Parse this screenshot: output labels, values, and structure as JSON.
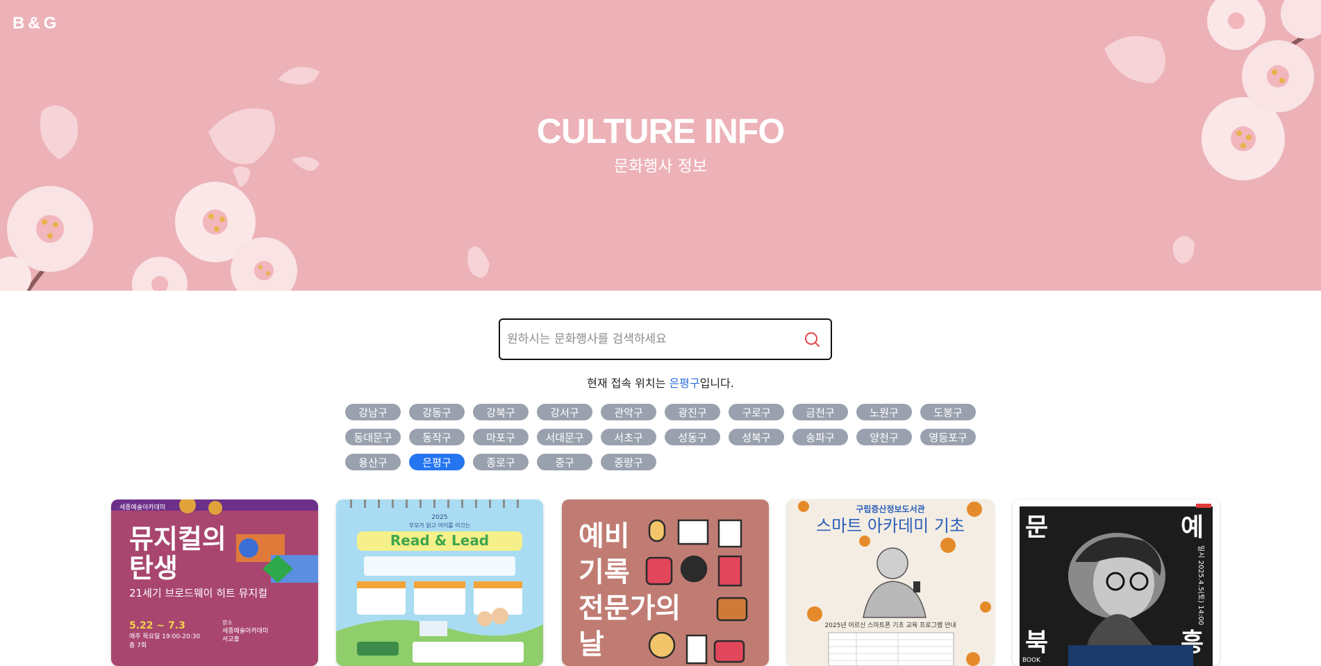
{
  "brand": {
    "logo": "B&G"
  },
  "hero": {
    "title": "CULTURE INFO",
    "subtitle": "문화행사 정보",
    "background_color": "#ecb2b8"
  },
  "search": {
    "placeholder": "원하시는 문화행사를 검색하세요",
    "value": "",
    "icon": "search-icon",
    "icon_color": "#e0434a"
  },
  "location": {
    "prefix": "현재 접속 위치는 ",
    "district": "은평구",
    "suffix": "입니다.",
    "highlight_color": "#2b6fe0"
  },
  "districts": {
    "active_color": "#2575f1",
    "inactive_color": "#9aa1ae",
    "items": [
      "강남구",
      "강동구",
      "강북구",
      "강서구",
      "관악구",
      "광진구",
      "구로구",
      "금천구",
      "노원구",
      "도봉구",
      "동대문구",
      "동작구",
      "마포구",
      "서대문구",
      "서초구",
      "성동구",
      "성북구",
      "송파구",
      "양천구",
      "영등포구",
      "용산구",
      "은평구",
      "종로구",
      "중구",
      "중랑구"
    ],
    "selected": "은평구"
  },
  "events": [
    {
      "poster_brand": "세종예술아카데미",
      "title_line1": "뮤지컬의",
      "title_line2": "탄생",
      "subtitle": "21세기 브로드웨이 히트 뮤지컬",
      "date": "5.22 ~ 7.3",
      "time": "매주 목요일 19:00-20:30",
      "sessions": "총 7회",
      "place_label": "장소",
      "place": "세종예술아카데미",
      "hall": "서교홀",
      "bg": "#a8466f"
    },
    {
      "year": "2025",
      "tagline": "부모가 읽고 아이를 이끄는",
      "title": "Read & Lead",
      "bg": "#a9dcf2"
    },
    {
      "title_line1": "예비",
      "title_line2": "기록",
      "title_line3": "전문가의",
      "title_line4": "날",
      "bg": "#c07c73"
    },
    {
      "org": "구립증산정보도서관",
      "title": "스마트 아카데미 기초",
      "caption": "2025년 어르신 스마트폰 기초 교육 프로그램 안내",
      "bg": "#f4ede3"
    },
    {
      "chars": [
        "문",
        "예",
        "북",
        "흥"
      ],
      "side_text": "일시 2025.4.5(토) 14:00",
      "badge": "BOOK",
      "bg": "#1c1c1c"
    }
  ]
}
